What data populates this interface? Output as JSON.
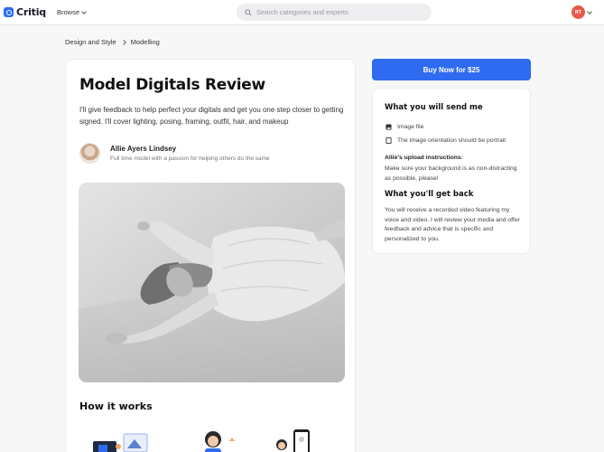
{
  "app": {
    "logo_text": "Critiq",
    "browse_label": "Browse",
    "search_placeholder": "Search categories and experts",
    "avatar_initials": "RT"
  },
  "breadcrumb": {
    "items": [
      "Design and Style",
      "Modelling"
    ]
  },
  "main": {
    "title": "Model Digitals Review",
    "description": "I'll give feedback to help perfect your digitals and get you one step closer to getting signed. I'll cover lighting, posing, framing, outfit, hair, and makeup",
    "expert_name": "Allie Ayers Lindsey",
    "expert_tagline": "Full time model with a passion for helping others do the same",
    "how_it_works": "How it works"
  },
  "sidebar": {
    "buy_label": "Buy Now for $25",
    "send_heading": "What you will send me",
    "requirements": [
      {
        "label": "Image file",
        "icon": "image-icon"
      },
      {
        "label": "The image orientation should be portrait",
        "icon": "portrait-orientation-icon"
      }
    ],
    "instructions_heading": "Allie's upload instructions:",
    "instructions_text": "Make sure your background is as non-distracting as possible, please!",
    "get_back_heading": "What you'll get back",
    "get_back_text": "You will receive a recorded video featuring my voice and video. I will review your media and offer feedback and advice that is specific and personalized to you."
  },
  "colors": {
    "accent": "#2f6bf0",
    "avatar_bg": "#e8594a",
    "page_bg": "#f7f7f8"
  }
}
